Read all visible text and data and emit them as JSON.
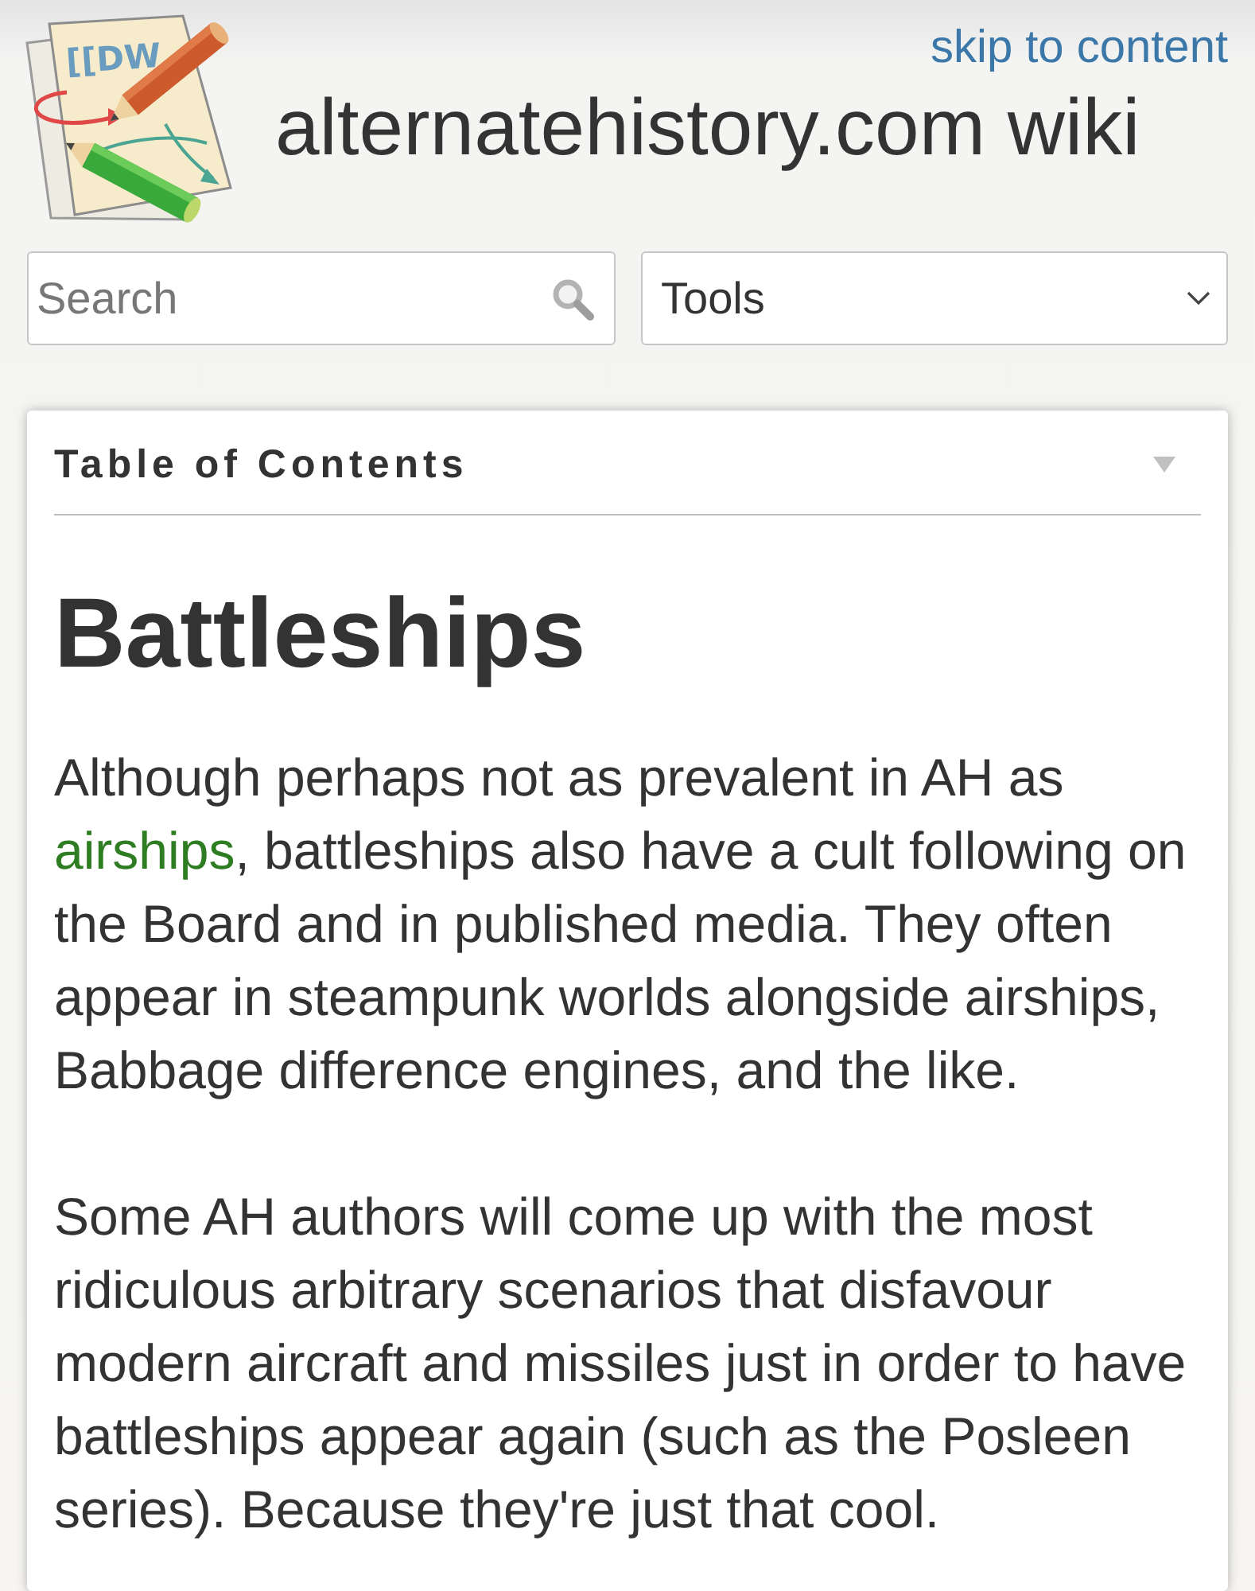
{
  "header": {
    "logo_text": "[[DW",
    "skip_link": "skip to content",
    "site_title": "alternatehistory.com wiki"
  },
  "search": {
    "placeholder": "Search"
  },
  "tools_select": {
    "label": "Tools"
  },
  "toc": {
    "title": "Table of Contents",
    "expanded": false
  },
  "article": {
    "title": "Battleships",
    "paragraphs": [
      {
        "segments": [
          {
            "kind": "text",
            "text": "Although perhaps not as prevalent in AH as "
          },
          {
            "kind": "link",
            "text": "airships"
          },
          {
            "kind": "text",
            "text": ", battleships also have a cult following on the Board and in published media. They often appear in steampunk worlds alongside airships, Babbage difference engines, and the like."
          }
        ]
      },
      {
        "segments": [
          {
            "kind": "text",
            "text": "Some AH authors will come up with the most ridiculous arbitrary scenarios that disfavour modern aircraft and missiles just in order to have battleships appear again (such as the Posleen series). Because they're just that cool."
          }
        ]
      }
    ]
  }
}
